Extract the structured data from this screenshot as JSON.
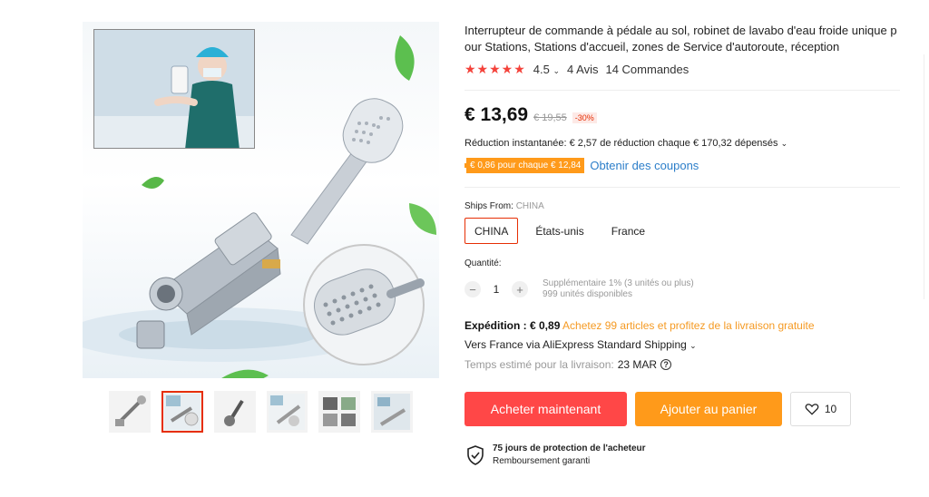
{
  "product": {
    "title": "Interrupteur de commande à pédale au sol, robinet de lavabo d'eau froide unique pour Stations, Stations d'accueil, zones de Service d'autoroute, réception"
  },
  "rating": {
    "stars": "★★★★★",
    "score": "4.5",
    "reviews": "4 Avis",
    "orders": "14 Commandes"
  },
  "price": {
    "current": "€ 13,69",
    "original": "€ 19,55",
    "discount": "-30%"
  },
  "promo": {
    "instant": "Réduction instantanée: € 2,57 de réduction chaque € 170,32 dépensés",
    "coupon_badge": "€ 0,86 pour chaque € 12,84",
    "coupon_link": "Obtenir des coupons"
  },
  "ships_from": {
    "label": "Ships From:",
    "selected": "CHINA",
    "options": [
      "CHINA",
      "États-unis",
      "France"
    ]
  },
  "quantity": {
    "label": "Quantité:",
    "value": "1",
    "minus": "−",
    "plus": "+",
    "info_line1": "Supplémentaire 1% (3 unités ou plus)",
    "info_line2": "999 unités disponibles"
  },
  "shipping": {
    "label": "Expédition : € 0,89",
    "promo": "Achetez 99 articles et profitez de la livraison gratuite",
    "method": "Vers France via AliExpress Standard Shipping",
    "delivery_label": "Temps estimé pour la livraison:",
    "delivery_date": "23 MAR",
    "help": "?"
  },
  "actions": {
    "buy_now": "Acheter maintenant",
    "add_to_cart": "Ajouter au panier",
    "wishlist_count": "10"
  },
  "protection": {
    "title": "75 jours de protection de l'acheteur",
    "subtitle": "Remboursement garanti"
  },
  "icons": {
    "star": "star-icon",
    "chevron": "chevron-down-icon",
    "heart": "heart-icon",
    "shield": "shield-check-icon"
  },
  "colors": {
    "accent_red": "#ff4747",
    "accent_orange": "#ff9a1a",
    "link_blue": "#2c7ec9"
  }
}
